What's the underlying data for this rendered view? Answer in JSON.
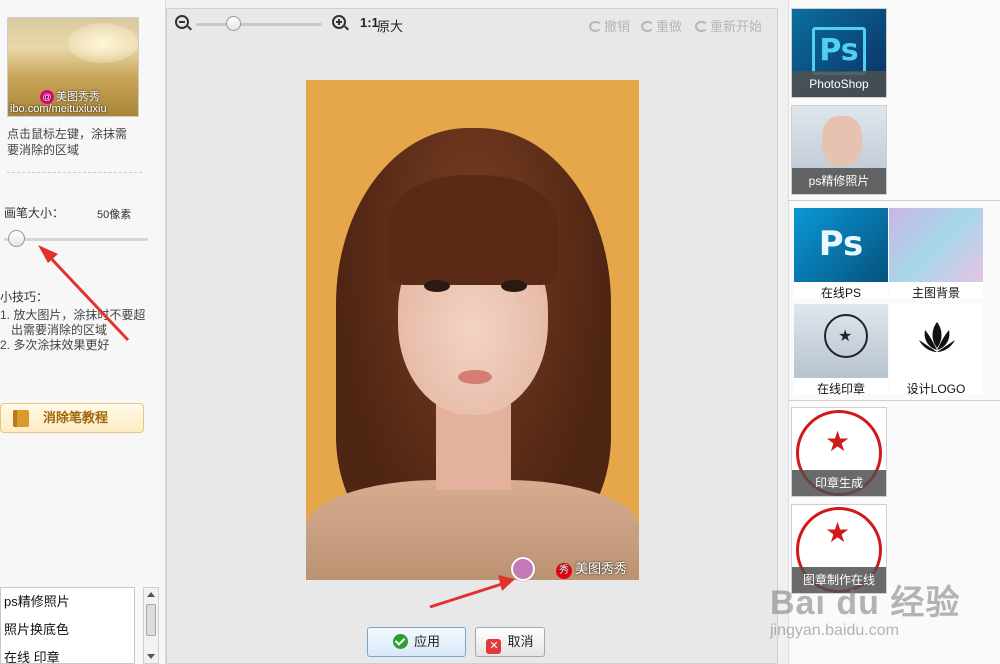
{
  "left_panel": {
    "thumb_watermark": "美图秀秀",
    "thumb_url": "ibo.com/meituxiuxiu",
    "hint": "点击鼠标左键，涂抹需要消除的区域",
    "brush_label": "画笔大小：",
    "brush_value": "50像素",
    "brush_level": 0.08,
    "tips_title": "小技巧：",
    "tips": [
      "1. 放大图片，涂抹时不要超出需要消除的区域",
      "2. 多次涂抹效果更好"
    ],
    "tutorial_button": "消除笔教程",
    "list_items": [
      "ps精修照片",
      "照片换底色",
      "在线 印章"
    ]
  },
  "toolbar": {
    "one_one": "1:1",
    "original_size": "原大",
    "undo": "撤销",
    "redo": "重做",
    "restart": "重新开始",
    "zoom_level": 0.3
  },
  "canvas": {
    "photo_watermark": "美图秀秀",
    "watermark_icon": "秀"
  },
  "actions": {
    "apply": "应用",
    "cancel": "取消"
  },
  "right_panel": {
    "cards": [
      "PhotoShop",
      "ps精修照片",
      "在线PS",
      "主图背景",
      "在线印章",
      "设计LOGO",
      "印章生成",
      "图章制作在线"
    ]
  },
  "overlay": {
    "baidu": "Bai du 经验",
    "baidu_url": "jingyan.baidu.com"
  },
  "colors": {
    "accent_red": "#e0332f",
    "apply_check": "#2ca02c",
    "brush_circle": "#c37ab6"
  }
}
